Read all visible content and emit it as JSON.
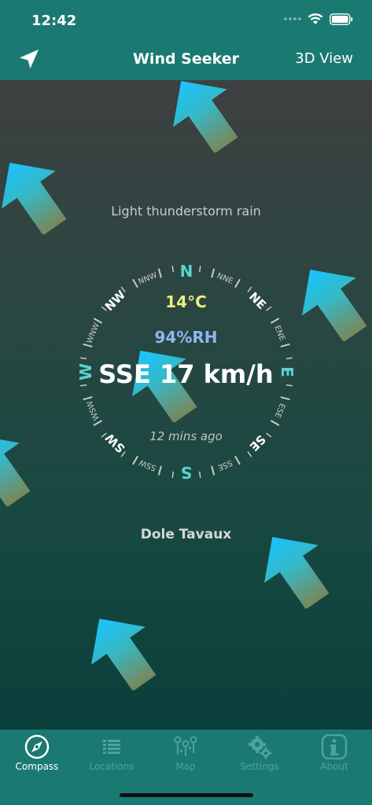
{
  "status_bar": {
    "time": "12:42"
  },
  "nav": {
    "title": "Wind Seeker",
    "right_button": "3D View",
    "left_icon": "navigation-arrow-icon"
  },
  "weather": {
    "description": "Light thunderstorm rain",
    "temperature": "14°C",
    "humidity": "94%RH",
    "wind": "SSE 17 km/h",
    "updated": "12 mins ago",
    "location": "Dole Tavaux"
  },
  "compass": {
    "primary": [
      "N",
      "E",
      "S",
      "W"
    ],
    "secondary": [
      "NE",
      "SE",
      "SW",
      "NW"
    ],
    "tertiary": [
      "NNE",
      "ENE",
      "ESE",
      "SSE",
      "SSW",
      "WSW",
      "WNW",
      "NNW"
    ],
    "colors": {
      "primary": "#5ad2d0",
      "secondary": "#ffffff",
      "tertiary": "#c8cccb"
    }
  },
  "tabs": [
    {
      "label": "Compass",
      "icon": "compass-icon",
      "active": true
    },
    {
      "label": "Locations",
      "icon": "list-icon",
      "active": false
    },
    {
      "label": "Map",
      "icon": "map-pins-icon",
      "active": false
    },
    {
      "label": "Settings",
      "icon": "gears-icon",
      "active": false
    },
    {
      "label": "About",
      "icon": "info-icon",
      "active": false
    }
  ],
  "colors": {
    "header": "#1a7a72",
    "arrow_top": "#19c3ff",
    "arrow_bottom": "#6f8a5c",
    "tab_inactive": "#4da29c",
    "tab_active": "#ffffff"
  }
}
